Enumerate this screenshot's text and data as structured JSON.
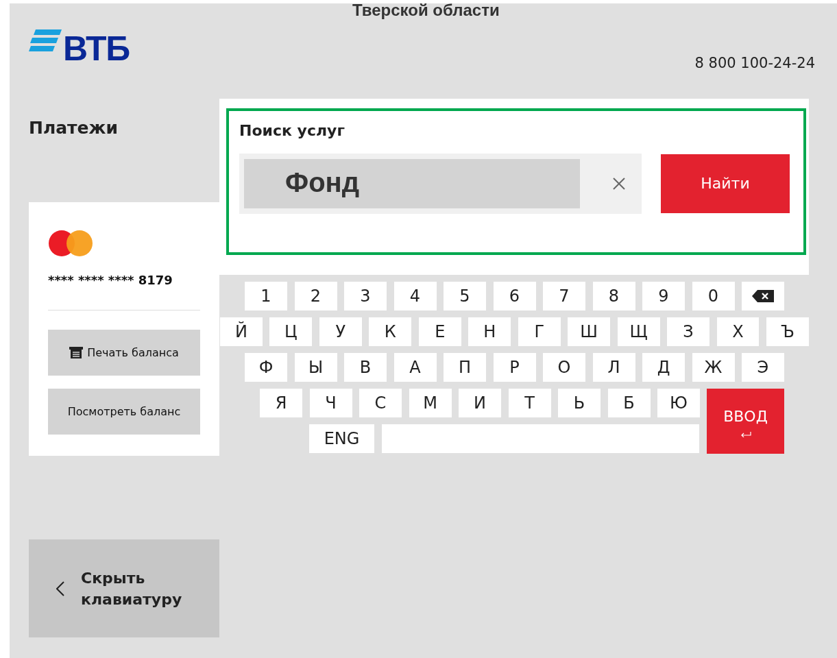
{
  "header": {
    "title": "Тверской области",
    "logo": "ВТБ",
    "phone": "8 800 100-24-24"
  },
  "sidebar": {
    "heading": "Платежи",
    "card": {
      "number": "**** **** **** 8179",
      "buttons": [
        {
          "kind": "print",
          "label": "Печать баланса"
        },
        {
          "kind": "view",
          "label": "Посмотреть баланс"
        }
      ]
    },
    "hide_keyboard": {
      "lines": [
        "Скрыть",
        "клавиатуру"
      ]
    }
  },
  "search": {
    "title": "Поиск услуг",
    "value": "Фонд",
    "submit": "Найти"
  },
  "keyboard": {
    "rows": [
      [
        {
          "kind": "char",
          "label": "1"
        },
        {
          "kind": "char",
          "label": "2"
        },
        {
          "kind": "char",
          "label": "3"
        },
        {
          "kind": "char",
          "label": "4"
        },
        {
          "kind": "char",
          "label": "5"
        },
        {
          "kind": "char",
          "label": "6"
        },
        {
          "kind": "char",
          "label": "7"
        },
        {
          "kind": "char",
          "label": "8"
        },
        {
          "kind": "char",
          "label": "9"
        },
        {
          "kind": "char",
          "label": "0"
        },
        {
          "kind": "backspace"
        }
      ],
      [
        {
          "kind": "char",
          "label": "Й"
        },
        {
          "kind": "char",
          "label": "Ц"
        },
        {
          "kind": "char",
          "label": "У"
        },
        {
          "kind": "char",
          "label": "К"
        },
        {
          "kind": "char",
          "label": "Е"
        },
        {
          "kind": "char",
          "label": "Н"
        },
        {
          "kind": "char",
          "label": "Г"
        },
        {
          "kind": "char",
          "label": "Ш"
        },
        {
          "kind": "char",
          "label": "Щ"
        },
        {
          "kind": "char",
          "label": "З"
        },
        {
          "kind": "char",
          "label": "Х"
        },
        {
          "kind": "char",
          "label": "Ъ"
        }
      ],
      [
        {
          "kind": "char",
          "label": "Ф"
        },
        {
          "kind": "char",
          "label": "Ы"
        },
        {
          "kind": "char",
          "label": "В"
        },
        {
          "kind": "char",
          "label": "А"
        },
        {
          "kind": "char",
          "label": "П"
        },
        {
          "kind": "char",
          "label": "Р"
        },
        {
          "kind": "char",
          "label": "О"
        },
        {
          "kind": "char",
          "label": "Л"
        },
        {
          "kind": "char",
          "label": "Д"
        },
        {
          "kind": "char",
          "label": "Ж"
        },
        {
          "kind": "char",
          "label": "Э"
        }
      ],
      [
        {
          "kind": "char",
          "label": "Я"
        },
        {
          "kind": "char",
          "label": "Ч"
        },
        {
          "kind": "char",
          "label": "С"
        },
        {
          "kind": "char",
          "label": "М"
        },
        {
          "kind": "char",
          "label": "И"
        },
        {
          "kind": "char",
          "label": "Т"
        },
        {
          "kind": "char",
          "label": "Ь"
        },
        {
          "kind": "char",
          "label": "Б"
        },
        {
          "kind": "char",
          "label": "Ю"
        }
      ],
      [
        {
          "kind": "lang",
          "label": "ENG"
        },
        {
          "kind": "space"
        }
      ]
    ],
    "enter": {
      "label": "ВВОД"
    }
  }
}
